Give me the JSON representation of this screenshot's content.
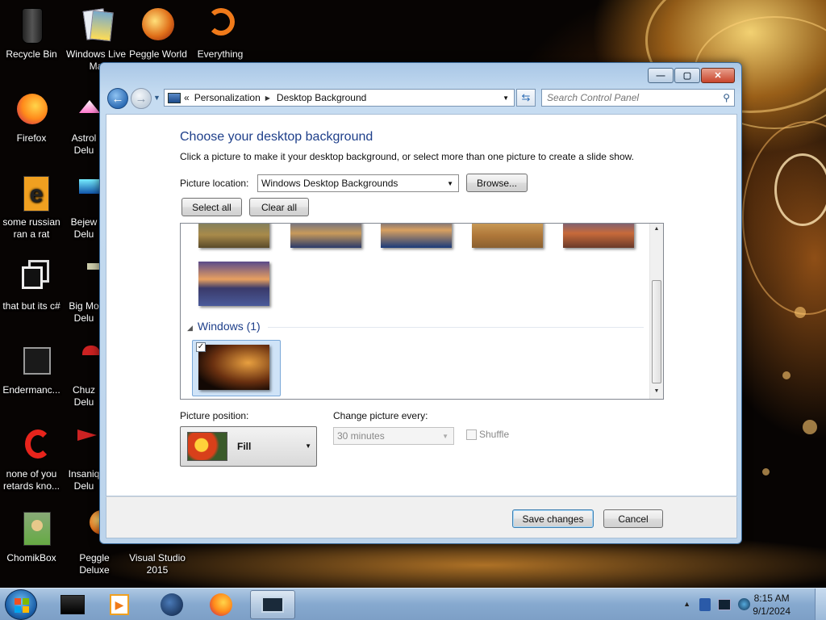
{
  "desktop": {
    "icons": [
      {
        "label": "Recycle Bin",
        "icon": "recycle-bin-icon"
      },
      {
        "label": "Windows Live Ma",
        "icon": "windows-live-icon"
      },
      {
        "label": "Peggle World",
        "icon": "peggle-icon"
      },
      {
        "label": "Everything",
        "icon": "everything-icon"
      },
      {
        "label": "Firefox",
        "icon": "firefox-icon"
      },
      {
        "label": "Astrol Delu",
        "icon": "game-icon"
      },
      {
        "label": "some russian ran a rat",
        "icon": "e-app-icon"
      },
      {
        "label": "Bejew Delu",
        "icon": "game-icon"
      },
      {
        "label": "that but its c#",
        "icon": "stacked-windows-icon"
      },
      {
        "label": "Big Mo Delu",
        "icon": "game-icon"
      },
      {
        "label": "Endermanc...",
        "icon": "monitor-icon"
      },
      {
        "label": "Chuz Delu",
        "icon": "game-icon"
      },
      {
        "label": "none of you retards kno...",
        "icon": "red-app-icon"
      },
      {
        "label": "Insaniq Delu",
        "icon": "game-icon"
      },
      {
        "label": "ChomikBox",
        "icon": "chomikbox-icon"
      },
      {
        "label": "Peggle Deluxe",
        "icon": "peggle-icon"
      },
      {
        "label": "Visual Studio 2015",
        "icon": "visual-studio-icon"
      }
    ]
  },
  "window": {
    "title_buttons": {
      "minimize": "—",
      "maximize": "▢",
      "close": "✕"
    },
    "breadcrumb": {
      "prefix": "«",
      "items": [
        "Personalization",
        "Desktop Background"
      ]
    },
    "search": {
      "placeholder": "Search Control Panel"
    },
    "heading": "Choose your desktop background",
    "subheading": "Click a picture to make it your desktop background, or select more than one picture to create a slide show.",
    "picture_location": {
      "label": "Picture location:",
      "value": "Windows Desktop Backgrounds",
      "browse": "Browse..."
    },
    "select_all": "Select all",
    "clear_all": "Clear all",
    "gallery": {
      "group_label": "Windows (1)",
      "selected_count": 1
    },
    "picture_position": {
      "label": "Picture position:",
      "value": "Fill"
    },
    "change_picture": {
      "label": "Change picture every:",
      "value": "30 minutes"
    },
    "shuffle": {
      "label": "Shuffle",
      "checked": false
    },
    "save": "Save changes",
    "cancel": "Cancel"
  },
  "taskbar": {
    "items": [
      "media-center-icon",
      "media-player-icon",
      "globe-icon",
      "firefox-icon",
      "desktop-background-window-icon"
    ],
    "clock": {
      "time": "8:15 AM",
      "date": "9/1/2024"
    }
  },
  "colors": {
    "heading": "#1e3f8a",
    "taskbar": "#86a9cf",
    "close": "#c8452c"
  }
}
